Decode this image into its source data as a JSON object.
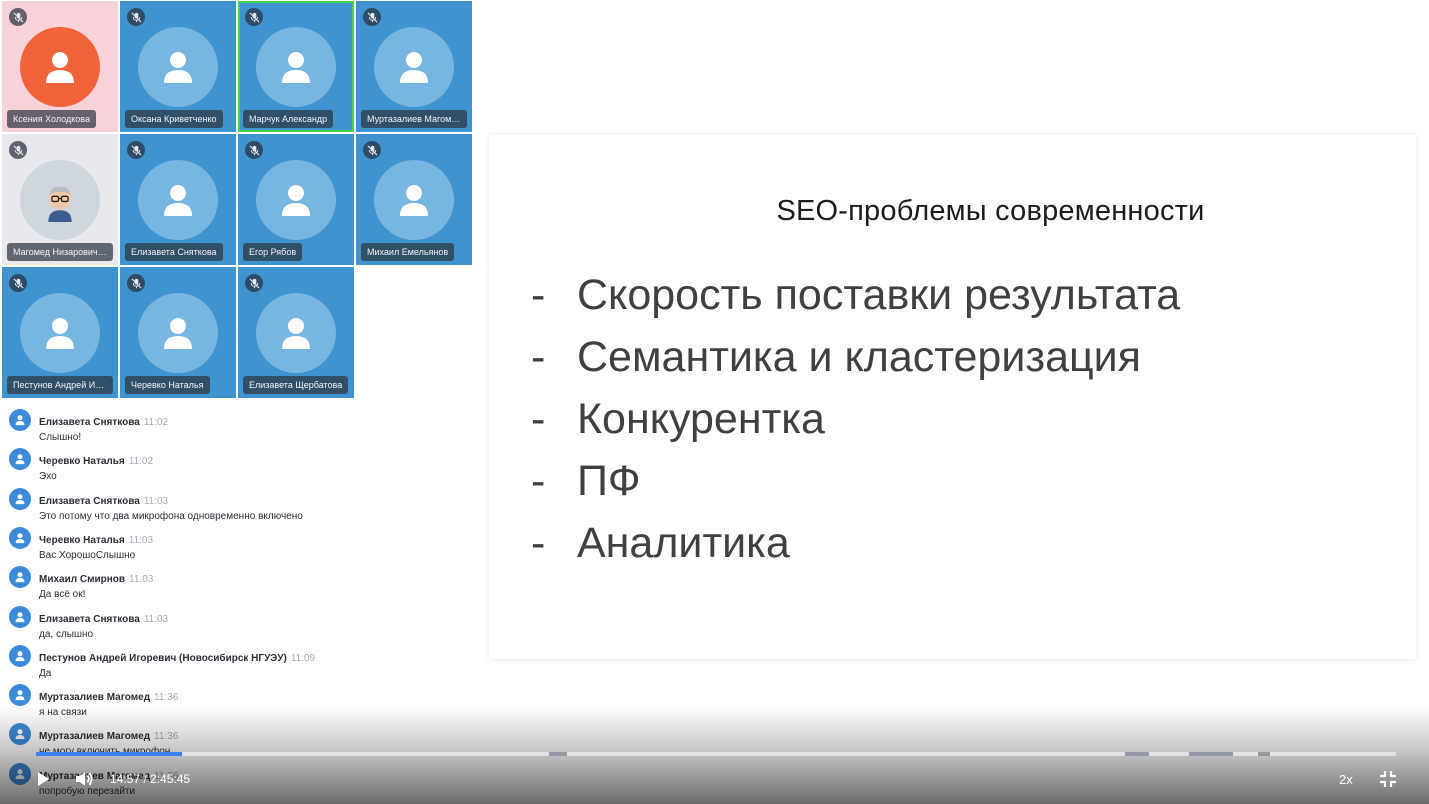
{
  "participants": [
    {
      "name": "Ксения Холодкова",
      "bg": "#f7d2d8",
      "avatar_bg": "#f0623a",
      "avatar": "person-icon",
      "speaking": false
    },
    {
      "name": "Оксана Криветченко",
      "bg": "#3f93cf",
      "avatar_bg": "#78b6e2",
      "avatar": "person-icon",
      "speaking": false
    },
    {
      "name": "Марчук Александр",
      "bg": "#3f93cf",
      "avatar_bg": "#78b6e2",
      "avatar": "person-icon",
      "speaking": true
    },
    {
      "name": "Муртазалиев Магомед",
      "bg": "#3f93cf",
      "avatar_bg": "#78b6e2",
      "avatar": "person-icon",
      "speaking": false
    },
    {
      "name": "Магомед Низарович М...",
      "bg": "#e7e9ec",
      "avatar_bg": "#cfd6de",
      "avatar": "cartoon-avatar",
      "speaking": false
    },
    {
      "name": "Елизавета Сняткова",
      "bg": "#3f93cf",
      "avatar_bg": "#78b6e2",
      "avatar": "person-icon",
      "speaking": false
    },
    {
      "name": "Егор Рябов",
      "bg": "#3f93cf",
      "avatar_bg": "#78b6e2",
      "avatar": "person-icon",
      "speaking": false
    },
    {
      "name": "Михаил Емельянов",
      "bg": "#3f93cf",
      "avatar_bg": "#78b6e2",
      "avatar": "person-icon",
      "speaking": false
    },
    {
      "name": "Пестунов Андрей Иго...",
      "bg": "#3f93cf",
      "avatar_bg": "#78b6e2",
      "avatar": "person-icon",
      "speaking": false
    },
    {
      "name": "Черевко Наталья",
      "bg": "#3f93cf",
      "avatar_bg": "#78b6e2",
      "avatar": "person-icon",
      "speaking": false
    },
    {
      "name": "Елизавета Щербатова",
      "bg": "#3f93cf",
      "avatar_bg": "#78b6e2",
      "avatar": "person-icon",
      "speaking": false
    }
  ],
  "chat": [
    {
      "author": "Елизавета Сняткова",
      "time": "11:02",
      "text": "Слышно!"
    },
    {
      "author": "Черевко Наталья",
      "time": "11:02",
      "text": "Эхо"
    },
    {
      "author": "Елизавета Сняткова",
      "time": "11:03",
      "text": "Это потому что два микрофона одновременно включено"
    },
    {
      "author": "Черевко Наталья",
      "time": "11:03",
      "text": "Вас ХорошоСлышно"
    },
    {
      "author": "Михаил Смирнов",
      "time": "11:03",
      "text": "Да всё ок!"
    },
    {
      "author": "Елизавета Сняткова",
      "time": "11:03",
      "text": "да, слышно"
    },
    {
      "author": "Пестунов Андрей Игоревич (Новосибирск НГУЭУ)",
      "time": "11:09",
      "text": "Да"
    },
    {
      "author": "Муртазалиев Магомед",
      "time": "11:36",
      "text": "я на связи"
    },
    {
      "author": "Муртазалиев Магомед",
      "time": "11:36",
      "text": "не могу включить микрофон"
    },
    {
      "author": "Муртазалиев Магомед",
      "time": "11:36",
      "text": "попробую перезайти"
    }
  ],
  "slide": {
    "title": "SEO-проблемы  современности",
    "bullet_marker": "-",
    "bullets": [
      "Скорость поставки результата",
      "Семантика и кластеризация",
      "Конкурентка",
      "ПФ",
      "Аналитика"
    ]
  },
  "player": {
    "current_time": "14:57",
    "total_time": "2:45:45",
    "time_label": "14:57 / 2:45:45",
    "speed": "2x",
    "play_icon": "play-icon",
    "volume_icon": "volume-icon",
    "exit_fullscreen_icon": "exit-fullscreen-icon"
  },
  "progress": {
    "played": 0.107
  },
  "colors": {
    "accent": "#3b82f6",
    "speaking": "#45d24e",
    "chat_avatar": "#3d8bd8"
  }
}
